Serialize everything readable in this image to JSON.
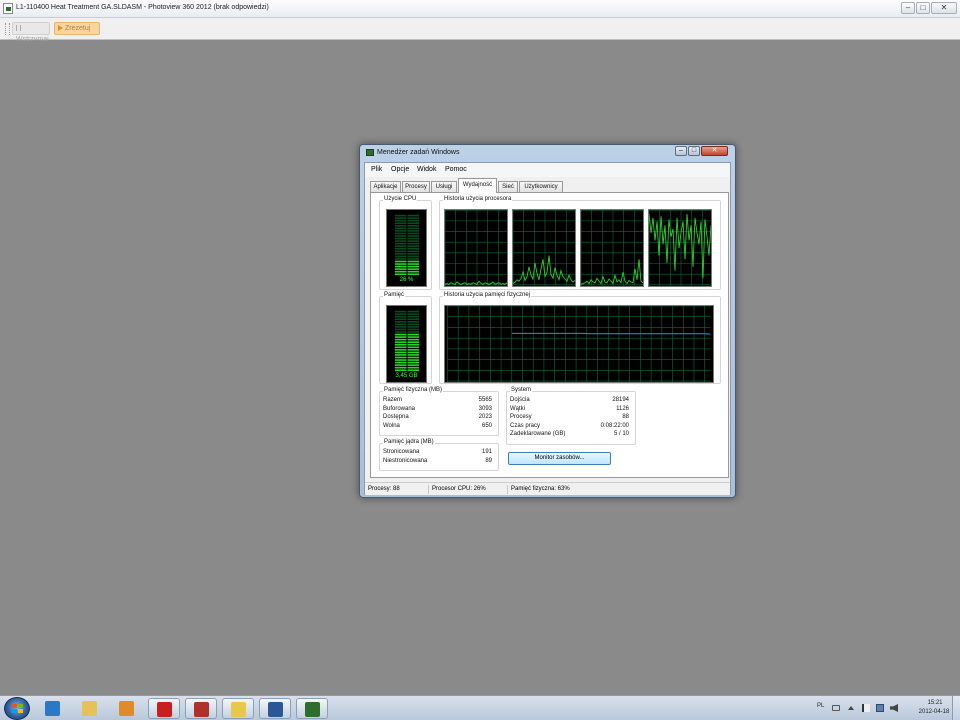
{
  "app": {
    "title": "L1-110400 Heat Treatment GA.SLDASM - Photoview 360 2012 (brak odpowiedzi)",
    "controls": {
      "minimize": "–",
      "maximize": "□",
      "close": "✕"
    },
    "toolbar": {
      "stop_label": "Wstrzymaj",
      "save_label": "Zrezetuj"
    }
  },
  "task_manager": {
    "title": "Menedżer zadań Windows",
    "controls": {
      "minimize": "–",
      "maximize": "□",
      "close": "✕"
    },
    "menu": {
      "plik": "Plik",
      "opcje": "Opcje",
      "widok": "Widok",
      "pomoc": "Pomoc"
    },
    "tabs": {
      "aplikacje": "Aplikacje",
      "procesy": "Procesy",
      "uslugi": "Usługi",
      "wydajnosc": "Wydajność",
      "siec": "Sieć",
      "uzytkownicy": "Użytkownicy"
    },
    "active_tab": "wydajnosc",
    "cpu": {
      "label": "Użycie CPU",
      "value_text": "26 %",
      "fraction": 0.26
    },
    "cpu_history": {
      "label": "Historia użycia procesora",
      "cores": [
        [
          2,
          3,
          2,
          4,
          3,
          2,
          5,
          3,
          2,
          3,
          4,
          2,
          3,
          2,
          4,
          3,
          2,
          6,
          3,
          2,
          4,
          3,
          2,
          3,
          5,
          2,
          3,
          4,
          2,
          3,
          2,
          4
        ],
        [
          3,
          5,
          8,
          6,
          10,
          18,
          7,
          12,
          25,
          14,
          9,
          30,
          16,
          8,
          22,
          35,
          12,
          18,
          40,
          15,
          10,
          24,
          14,
          8,
          20,
          12,
          9,
          6,
          14,
          8,
          5,
          7
        ],
        [
          2,
          3,
          4,
          6,
          3,
          8,
          5,
          4,
          10,
          6,
          3,
          12,
          5,
          4,
          9,
          6,
          3,
          14,
          5,
          8,
          4,
          18,
          6,
          3,
          7,
          5,
          4,
          22,
          8,
          35,
          6,
          4
        ],
        [
          95,
          70,
          90,
          60,
          85,
          40,
          92,
          55,
          80,
          30,
          88,
          65,
          75,
          20,
          90,
          50,
          70,
          85,
          35,
          95,
          60,
          80,
          25,
          90,
          70,
          55,
          85,
          10,
          88,
          65,
          40,
          80
        ]
      ]
    },
    "memory": {
      "label": "Pamięć",
      "value_text": "3,45 GB",
      "fraction": 0.63
    },
    "memory_history": {
      "label": "Historia użycia pamięci fizycznej",
      "values": [
        64,
        64,
        64,
        64,
        64,
        64,
        64,
        64,
        64,
        64,
        64,
        63.5,
        63.5,
        63.5,
        63.5,
        63.5,
        63.5,
        63.5,
        63.5,
        63.5,
        63.5,
        63.5,
        63.5,
        63.5,
        63.5,
        63.5,
        63.5,
        63.5,
        63
      ]
    },
    "physical_memory": {
      "label": "Pamięć fizyczna (MB)",
      "rows": [
        {
          "k": "Razem",
          "v": "5565"
        },
        {
          "k": "Buforowana",
          "v": "3093"
        },
        {
          "k": "Dostępna",
          "v": "2023"
        },
        {
          "k": "Wolna",
          "v": "650"
        }
      ]
    },
    "kernel_memory": {
      "label": "Pamięć jądra (MB)",
      "rows": [
        {
          "k": "Stronicowana",
          "v": "191"
        },
        {
          "k": "Niestronicowana",
          "v": "89"
        }
      ]
    },
    "system": {
      "label": "System",
      "rows": [
        {
          "k": "Dojścia",
          "v": "28194"
        },
        {
          "k": "Wątki",
          "v": "1126"
        },
        {
          "k": "Procesy",
          "v": "88"
        },
        {
          "k": "Czas pracy",
          "v": "0:08:22:00"
        },
        {
          "k": "Zadeklarowane (GB)",
          "v": "5 / 10"
        }
      ]
    },
    "resource_monitor_button": "Monitor zasobów...",
    "status": {
      "processes": "Procesy: 88",
      "cpu": "Procesor CPU: 26%",
      "memory": "Pamięć fizyczna: 63%"
    },
    "colors": {
      "graph_green": "#2bd62b",
      "graph_grid": "#0a6e3a",
      "memory_line": "#2f8fd8"
    }
  },
  "taskbar": {
    "apps": [
      {
        "name": "internet-explorer-icon",
        "color": "#2a78c8",
        "open": false
      },
      {
        "name": "windows-explorer-icon",
        "color": "#e6c15a",
        "open": false
      },
      {
        "name": "media-player-icon",
        "color": "#e08a2a",
        "open": false
      },
      {
        "name": "solidworks-icon",
        "color": "#c8201e",
        "open": true
      },
      {
        "name": "photoview-icon",
        "color": "#b0302a",
        "open": true
      },
      {
        "name": "notes-icon",
        "color": "#e8c84a",
        "open": true
      },
      {
        "name": "word-icon",
        "color": "#2b579a",
        "open": true
      },
      {
        "name": "task-manager-icon",
        "color": "#2f6d2f",
        "open": true
      }
    ],
    "tray": {
      "language": "PL",
      "time": "15:21",
      "date": "2012-04-18"
    }
  }
}
